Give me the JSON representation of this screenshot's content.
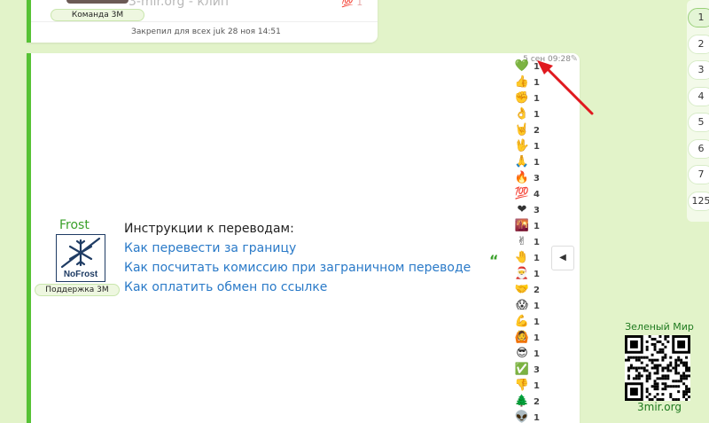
{
  "top_post": {
    "badge": "Команда 3М",
    "title_faded": "3-mir.org - клип",
    "reaction_faded": "💯 1",
    "pinned_text": "Закрепил для всех juk 28 ноя 14:51"
  },
  "post": {
    "timestamp": "5 сен 09:28",
    "author": {
      "name": "Frost",
      "avatar_text": "NoFrost",
      "badge": "Поддержка 3М"
    },
    "instructions_title": "Инструкции к переводам:",
    "links": [
      "Как перевести за границу",
      "Как посчитать комиссию при заграничном переводе",
      "Как оплатить обмен по ссылке"
    ],
    "quote_icon": "quote-icon"
  },
  "reactions": [
    {
      "emoji": "💚",
      "icon": "green-heart-icon",
      "count": "1"
    },
    {
      "emoji": "👍",
      "icon": "thumbs-up-icon",
      "count": "1"
    },
    {
      "emoji": "✊",
      "icon": "raised-fist-icon",
      "count": "1"
    },
    {
      "emoji": "👌",
      "icon": "ok-hand-icon",
      "count": "1"
    },
    {
      "emoji": "🤘",
      "icon": "horns-icon",
      "count": "2"
    },
    {
      "emoji": "🖖",
      "icon": "vulcan-salute-icon",
      "count": "1"
    },
    {
      "emoji": "🙏",
      "icon": "folded-hands-icon",
      "count": "1"
    },
    {
      "emoji": "🔥",
      "icon": "fire-icon",
      "count": "3"
    },
    {
      "emoji": "💯",
      "icon": "hundred-icon",
      "count": "4"
    },
    {
      "emoji": "❤",
      "icon": "red-heart-icon",
      "count": "3"
    },
    {
      "emoji": "🌇",
      "icon": "sunset-icon",
      "count": "1"
    },
    {
      "emoji": "✌",
      "icon": "victory-hand-icon",
      "count": "1"
    },
    {
      "emoji": "🤚",
      "icon": "raised-back-hand-icon",
      "count": "1"
    },
    {
      "emoji": "🎅",
      "icon": "santa-icon",
      "count": "1"
    },
    {
      "emoji": "🤝",
      "icon": "handshake-icon",
      "count": "2"
    },
    {
      "emoji": "😱",
      "icon": "scream-icon",
      "count": "1"
    },
    {
      "emoji": "💪",
      "icon": "flexed-biceps-icon",
      "count": "1"
    },
    {
      "emoji": "🙆",
      "icon": "person-ok-icon",
      "count": "1"
    },
    {
      "emoji": "😎",
      "icon": "sunglasses-face-icon",
      "count": "1"
    },
    {
      "emoji": "✅",
      "icon": "check-mark-icon",
      "count": "3"
    },
    {
      "emoji": "👎",
      "icon": "thumbs-down-icon",
      "count": "1"
    },
    {
      "emoji": "🌲",
      "icon": "tree-icon",
      "count": "2"
    },
    {
      "emoji": "👽",
      "icon": "alien-icon",
      "count": "1"
    }
  ],
  "pager": {
    "pages": [
      "1",
      "2",
      "3",
      "4",
      "5",
      "6",
      "7",
      "125"
    ],
    "active": "1"
  },
  "promo": {
    "title": "Зеленый Мир",
    "site": "3mir.org"
  },
  "colors": {
    "background": "#e2f3c9",
    "accent_green": "#56c235",
    "link_blue": "#2a7ac8",
    "arrow_red": "#e0191f"
  }
}
